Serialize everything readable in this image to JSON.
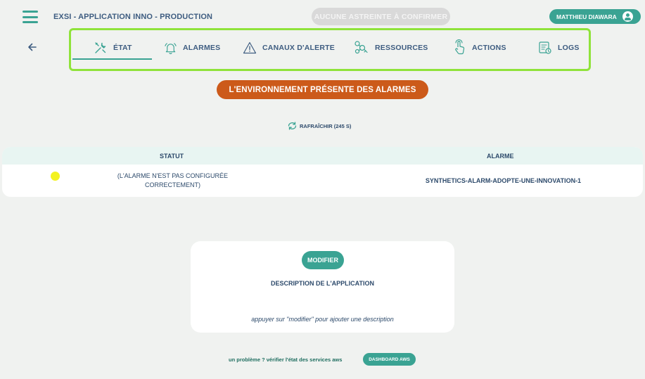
{
  "header": {
    "app_title": "EXSI - APPLICATION INNO - PRODUCTION",
    "oncall_status": "AUCUNE ASTREINTE À CONFIRMER",
    "user_name": "MATTHIEU DIAWARA"
  },
  "nav": {
    "tabs": [
      {
        "label": "ÉTAT",
        "icon": "tools-icon",
        "active": true
      },
      {
        "label": "ALARMES",
        "icon": "bell-icon",
        "active": false
      },
      {
        "label": "CANAUX D'ALERTE",
        "icon": "warning-triangle-icon",
        "active": false
      },
      {
        "label": "RESSOURCES",
        "icon": "resources-icon",
        "active": false
      },
      {
        "label": "ACTIONS",
        "icon": "hand-pointer-icon",
        "active": false
      },
      {
        "label": "LOGS",
        "icon": "logs-icon",
        "active": false
      }
    ]
  },
  "banner": {
    "text": "L'ENVIRONNEMENT PRÉSENTE DES ALARMES"
  },
  "refresh": {
    "label": "RAFRAÎCHIR (245 S)"
  },
  "table": {
    "columns": [
      "STATUT",
      "ALARME"
    ],
    "rows": [
      {
        "status_color": "#f3f21f",
        "status_text": "(L'ALARME N'EST PAS CONFIGURÉE CORRECTEMENT)",
        "alarm": "SYNTHETICS-ALARM-ADOPTE-UNE-INNOVATION-1"
      }
    ]
  },
  "description": {
    "modify_label": "MODIFIER",
    "title": "DESCRIPTION DE L'APPLICATION",
    "hint": "appuyer sur \"modifier\" pour ajouter une description"
  },
  "footer": {
    "text": "un problème ? vérifier l'état des services aws",
    "button_label": "DASHBOARD AWS"
  },
  "colors": {
    "accent": "#3aa393",
    "alarm_banner": "#cc5a1a",
    "nav_outline": "#8fe33a",
    "status_warning": "#f3f21f"
  }
}
